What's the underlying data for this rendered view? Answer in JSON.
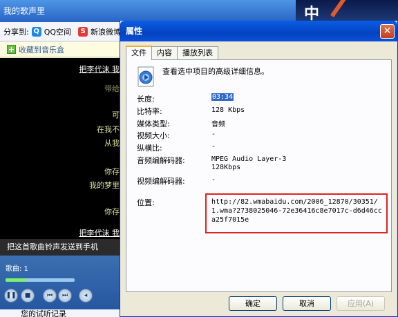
{
  "background_app": {
    "title": "我的歌声里",
    "share_label": "分享到:",
    "share_links": [
      "QQ空间",
      "新浪微博"
    ],
    "favorite_label": "收藏到音乐盒",
    "lyrics": [
      "把李代沫 我",
      "带给",
      "可",
      "在我不",
      "从我",
      "你存",
      "我的梦里",
      "你存",
      "把李代沫 我"
    ],
    "send_banner": "把这首歌曲铃声发送到手机",
    "song_label": "歌曲: 1",
    "history_label": "您的试听记录",
    "right_header_glyph": "中"
  },
  "dialog": {
    "title": "属性",
    "close_symbol": "✕",
    "tabs": [
      "文件",
      "内容",
      "播放列表"
    ],
    "description": "查看选中项目的高级详细信息。",
    "properties": [
      {
        "label": "长度:",
        "value": "03:34"
      },
      {
        "label": "比特率:",
        "value": "128 Kbps"
      },
      {
        "label": "媒体类型:",
        "value": "音频"
      },
      {
        "label": "视频大小:",
        "value": "-"
      },
      {
        "label": "纵横比:",
        "value": "-"
      },
      {
        "label": "音频编解码器:",
        "value": "MPEG Audio Layer-3",
        "value2": "128Kbps"
      },
      {
        "label": "视频编解码器:",
        "value": "-"
      }
    ],
    "location_label": "位置:",
    "location_value": "http://82.wmabaidu.com/2006_12870/30351/1.wma?2738025046-72e36416c8e7017c-d6d46cca25f7015e",
    "buttons": {
      "ok": "确定",
      "cancel": "取消",
      "apply": "应用(A)"
    }
  }
}
